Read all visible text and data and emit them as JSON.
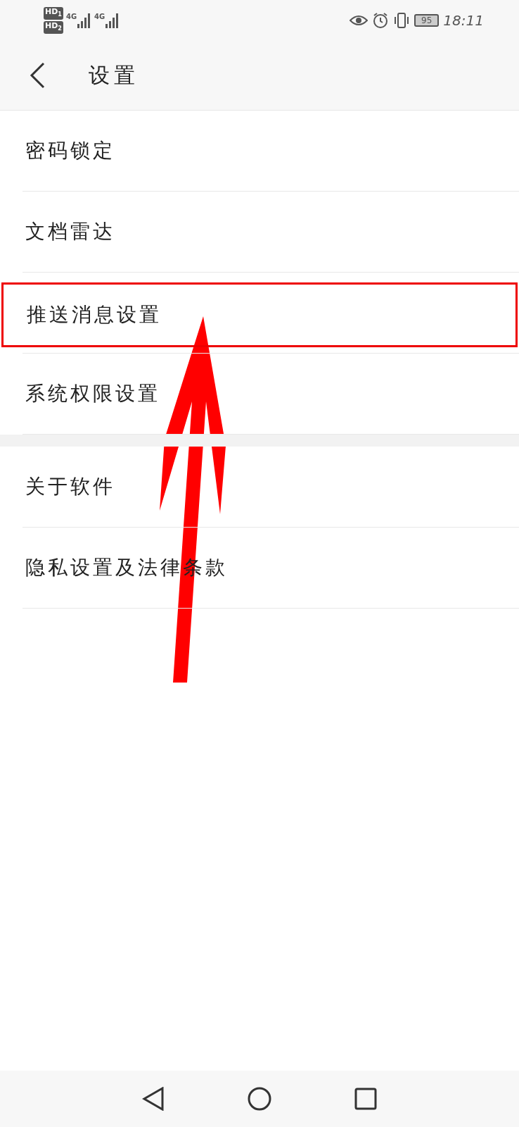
{
  "status_bar": {
    "sims": [
      {
        "hd": "HD",
        "slot": "1",
        "net": "4G"
      },
      {
        "hd": "HD",
        "slot": "2",
        "net": "4G"
      }
    ],
    "battery": "95",
    "time": "18:11"
  },
  "header": {
    "title": "设置"
  },
  "sections": [
    [
      {
        "label": "密码锁定",
        "highlighted": false
      },
      {
        "label": "文档雷达",
        "highlighted": false
      },
      {
        "label": "推送消息设置",
        "highlighted": true
      },
      {
        "label": "系统权限设置",
        "highlighted": false
      }
    ],
    [
      {
        "label": "关于软件",
        "highlighted": false
      },
      {
        "label": "隐私设置及法律条款",
        "highlighted": false
      }
    ]
  ]
}
